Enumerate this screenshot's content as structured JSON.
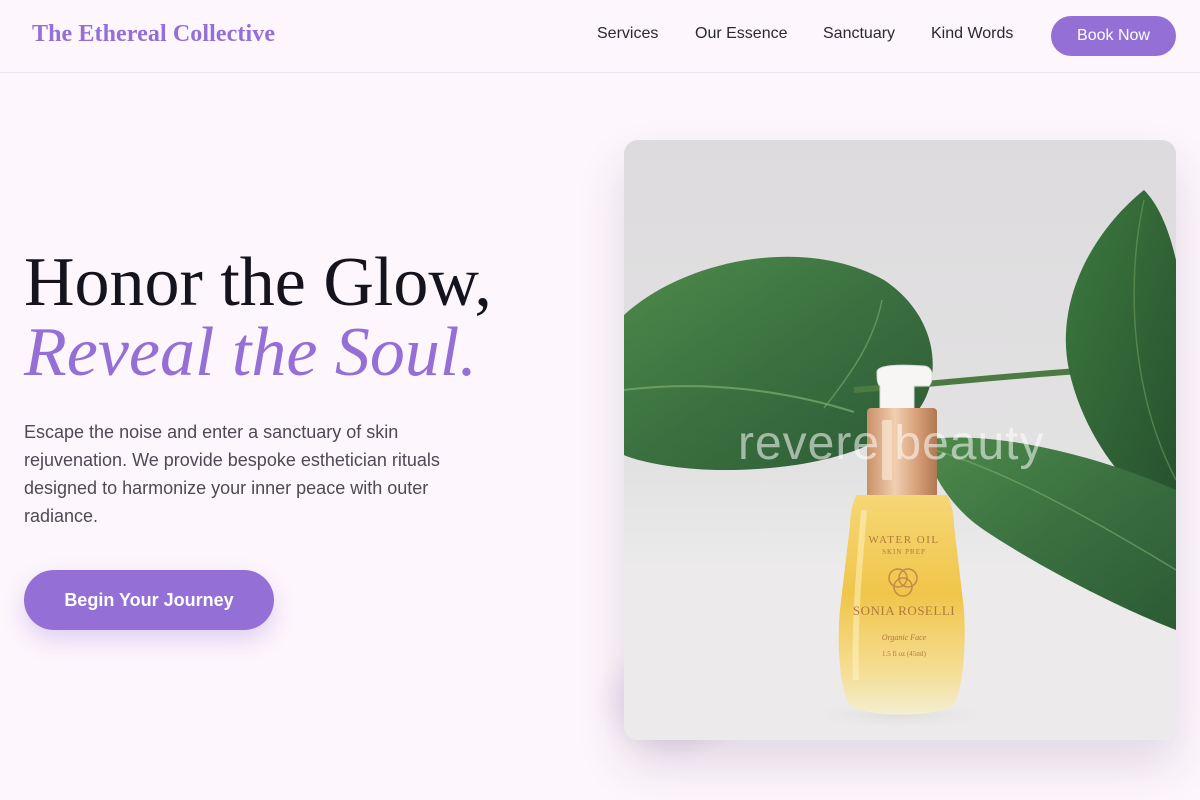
{
  "nav": {
    "brand": "The Ethereal Collective",
    "links": [
      "Services",
      "Our Essence",
      "Sanctuary",
      "Kind Words"
    ],
    "cta": "Book Now"
  },
  "hero": {
    "title_line1": "Honor the Glow,",
    "title_line2": "Reveal the Soul.",
    "description": "Escape the noise and enter a sanctuary of skin rejuvenation. We provide bespoke esthetician rituals designed to harmonize your inner peace with outer radiance.",
    "cta": "Begin Your Journey"
  },
  "image": {
    "watermark": "revere beauty",
    "bottle_line1": "WATER OIL",
    "bottle_line2": "SKIN PREP",
    "bottle_brand": "SONIA ROSELLI",
    "bottle_line3": "Organic Face",
    "bottle_line4": "1.5 fl oz (45ml)"
  },
  "colors": {
    "accent": "#9470d6",
    "background": "#fdf6fc",
    "heading": "#15131d",
    "body_text": "#4d4a55"
  }
}
